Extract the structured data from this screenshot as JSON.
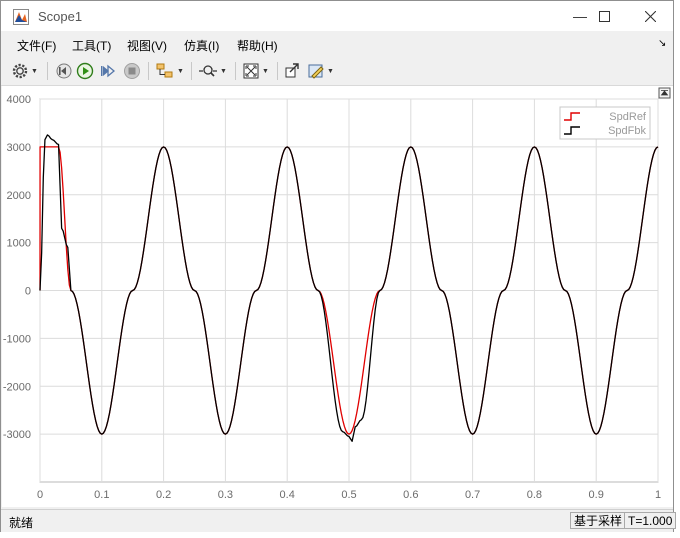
{
  "window": {
    "title": "Scope1"
  },
  "menu": [
    "文件(F)",
    "工具(T)",
    "视图(V)",
    "仿真(I)",
    "帮助(H)"
  ],
  "toolbar": {
    "icons": [
      "settings-icon",
      "step-back-icon",
      "run-icon",
      "step-forward-icon",
      "stop-icon",
      "highlight-block-icon",
      "zoom-icon",
      "autoscale-icon",
      "restore-layout-icon",
      "edit-style-icon"
    ]
  },
  "status": {
    "left": "就绪",
    "mode": "基于采样",
    "time": "T=1.000"
  },
  "colors": {
    "ref": "#e00000",
    "fbk": "#000000",
    "grid": "#dcdcdc",
    "axis_text": "#6b6b6b"
  },
  "chart_data": {
    "type": "line",
    "title": "",
    "xlabel": "",
    "ylabel": "",
    "xlim": [
      0,
      1
    ],
    "ylim": [
      -4000,
      4000
    ],
    "xticks": [
      0,
      0.1,
      0.2,
      0.3,
      0.4,
      0.5,
      0.6,
      0.7,
      0.8,
      0.9,
      1
    ],
    "yticks": [
      4000,
      3000,
      2000,
      1000,
      0,
      -1000,
      -2000,
      -3000
    ],
    "xtick_labels": [
      "0",
      "0.1",
      "0.2",
      "0.3",
      "0.4",
      "0.5",
      "0.6",
      "0.7",
      "0.8",
      "0.9",
      "1"
    ],
    "ytick_labels": [
      "4000",
      "3000",
      "2000",
      "1000",
      "0",
      "-1000",
      "-2000",
      "-3000"
    ],
    "grid": true,
    "legend": {
      "placement": "top-right"
    },
    "series": [
      {
        "name": "SpdRef",
        "color": "#e00000",
        "x": [
          0,
          0.0001,
          0.03,
          0.05,
          0.1,
          0.15,
          0.2,
          0.25,
          0.3,
          0.35,
          0.4,
          0.45,
          0.5,
          0.55,
          0.6,
          0.65,
          0.7,
          0.75,
          0.8,
          0.85,
          0.9,
          0.95,
          1.0
        ],
        "y": [
          0,
          3000,
          3000,
          0,
          -3000,
          0,
          3000,
          0,
          -3000,
          0,
          3000,
          0,
          -3000,
          0,
          3000,
          0,
          -3000,
          0,
          3000,
          0,
          -3000,
          0,
          3000
        ]
      },
      {
        "name": "SpdFbk",
        "color": "#000000",
        "x": [
          0,
          0.008,
          0.012,
          0.02,
          0.03,
          0.035,
          0.045,
          0.05,
          0.1,
          0.15,
          0.2,
          0.25,
          0.3,
          0.35,
          0.4,
          0.45,
          0.49,
          0.5,
          0.505,
          0.51,
          0.52,
          0.55,
          0.6,
          0.65,
          0.7,
          0.75,
          0.8,
          0.85,
          0.9,
          0.95,
          1.0
        ],
        "y": [
          0,
          3150,
          3250,
          3150,
          3050,
          1300,
          900,
          0,
          -3000,
          0,
          3000,
          0,
          -3000,
          0,
          3000,
          0,
          -2950,
          -3050,
          -3150,
          -2850,
          -2700,
          0,
          3000,
          0,
          -3000,
          0,
          3000,
          0,
          -3000,
          0,
          3000
        ]
      }
    ]
  }
}
